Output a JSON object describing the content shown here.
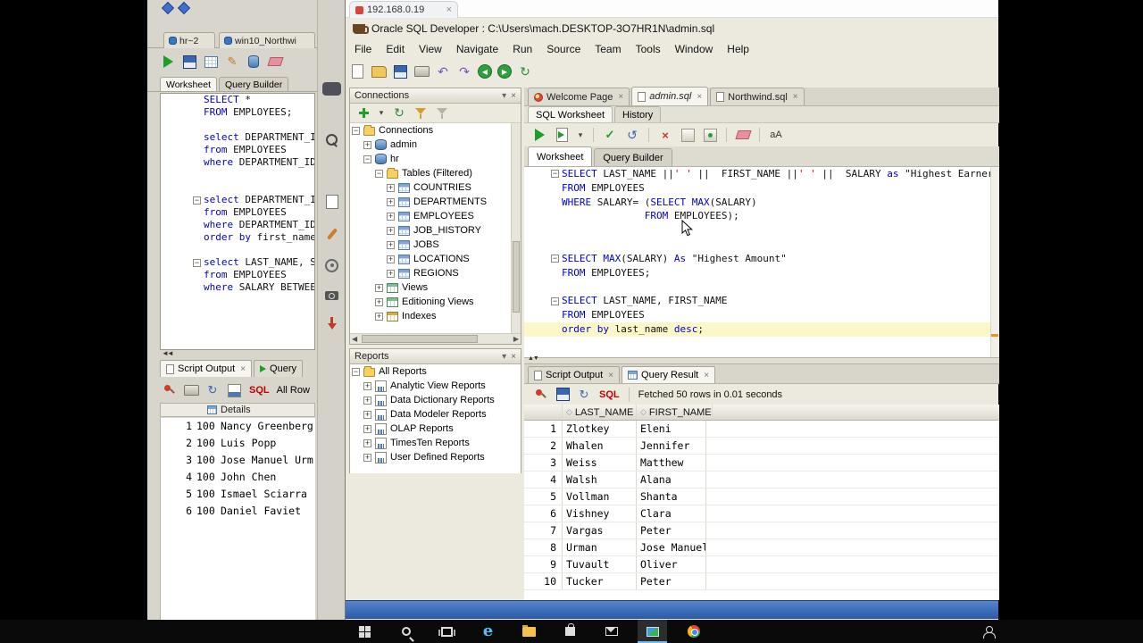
{
  "capture_toolbar": {
    "icons": [
      "capture-button",
      "magnifier",
      "clipboard",
      "brush",
      "gear",
      "camera",
      "download"
    ]
  },
  "background_window": {
    "doc_tabs": [
      {
        "label": "hr~2"
      },
      {
        "label": "win10_Northwi"
      }
    ],
    "toolbar_icons": [
      "run-statement",
      "save",
      "grid",
      "pencil",
      "db",
      "clear"
    ],
    "worksheet_tabs": {
      "worksheet": "Worksheet",
      "query_builder": "Query Builder"
    },
    "code": [
      {
        "t": [
          [
            "k",
            "SELECT"
          ],
          [
            "p",
            " *"
          ]
        ]
      },
      {
        "t": [
          [
            "k",
            "FROM"
          ],
          [
            "p",
            " EMPLOYEES;"
          ]
        ]
      },
      {
        "t": []
      },
      {
        "t": [
          [
            "k",
            "select"
          ],
          [
            "p",
            " DEPARTMENT_I"
          ]
        ]
      },
      {
        "t": [
          [
            "k",
            "from"
          ],
          [
            "p",
            " EMPLOYEES"
          ]
        ]
      },
      {
        "t": [
          [
            "k",
            "where"
          ],
          [
            "p",
            " DEPARTMENT_ID"
          ]
        ]
      },
      {
        "t": []
      },
      {
        "t": []
      },
      {
        "fold": true,
        "t": [
          [
            "k",
            "select"
          ],
          [
            "p",
            " DEPARTMENT_I"
          ]
        ]
      },
      {
        "t": [
          [
            "k",
            "from"
          ],
          [
            "p",
            " EMPLOYEES"
          ]
        ]
      },
      {
        "t": [
          [
            "k",
            "where"
          ],
          [
            "p",
            " DEPARTMENT_ID"
          ]
        ]
      },
      {
        "t": [
          [
            "k",
            "order"
          ],
          [
            "p",
            " "
          ],
          [
            "k",
            "by"
          ],
          [
            "p",
            " first_name"
          ]
        ]
      },
      {
        "t": []
      },
      {
        "fold": true,
        "t": [
          [
            "k",
            "select"
          ],
          [
            "p",
            " LAST_NAME, S"
          ]
        ]
      },
      {
        "t": [
          [
            "k",
            "from"
          ],
          [
            "p",
            " EMPLOYEES"
          ]
        ]
      },
      {
        "t": [
          [
            "k",
            "where"
          ],
          [
            "p",
            " SALARY BETWEE"
          ]
        ]
      }
    ],
    "bottom": {
      "tabs": [
        {
          "label": "Script Output",
          "close": "×"
        },
        {
          "label": "Query"
        }
      ],
      "toolbar_icons": [
        "pin",
        "print",
        "refresh-grid",
        "chart"
      ],
      "sql_label": "SQL",
      "rows_label": "All Row",
      "details_label": "Details",
      "rows": [
        [
          "1",
          "100",
          "Nancy Greenberg"
        ],
        [
          "2",
          "100",
          "Luis Popp"
        ],
        [
          "3",
          "100",
          "Jose Manuel Urm"
        ],
        [
          "4",
          "100",
          "John Chen"
        ],
        [
          "5",
          "100",
          "Ismael Sciarra"
        ],
        [
          "6",
          "100",
          "Daniel Faviet"
        ]
      ]
    }
  },
  "main_window": {
    "browser_tab": {
      "label": "192.168.0.19",
      "close": "×"
    },
    "title": "Oracle SQL Developer : C:\\Users\\mach.DESKTOP-3O7HR1N\\admin.sql",
    "menus": [
      "File",
      "Edit",
      "View",
      "Navigate",
      "Run",
      "Source",
      "Team",
      "Tools",
      "Window",
      "Help"
    ],
    "toolbar_icons": [
      "new-file",
      "open-file",
      "save",
      "print",
      "undo",
      "redo",
      "back",
      "forward",
      "refresh"
    ],
    "connections": {
      "title": "Connections",
      "toolbar_icons": [
        "add-connection",
        "dropdown",
        "refresh",
        "filter",
        "clear-filter"
      ],
      "tree": [
        {
          "d": 0,
          "e": "-",
          "i": "folder",
          "label": "Connections"
        },
        {
          "d": 1,
          "e": "+",
          "i": "db",
          "label": "admin"
        },
        {
          "d": 1,
          "e": "-",
          "i": "db",
          "label": "hr"
        },
        {
          "d": 2,
          "e": "-",
          "i": "folder",
          "label": "Tables (Filtered)"
        },
        {
          "d": 3,
          "e": "+",
          "i": "table",
          "label": "COUNTRIES"
        },
        {
          "d": 3,
          "e": "+",
          "i": "table",
          "label": "DEPARTMENTS"
        },
        {
          "d": 3,
          "e": "+",
          "i": "table",
          "label": "EMPLOYEES"
        },
        {
          "d": 3,
          "e": "+",
          "i": "table",
          "label": "JOB_HISTORY"
        },
        {
          "d": 3,
          "e": "+",
          "i": "table",
          "label": "JOBS"
        },
        {
          "d": 3,
          "e": "+",
          "i": "table",
          "label": "LOCATIONS"
        },
        {
          "d": 3,
          "e": "+",
          "i": "table",
          "label": "REGIONS"
        },
        {
          "d": 2,
          "e": "+",
          "i": "views",
          "label": "Views"
        },
        {
          "d": 2,
          "e": "+",
          "i": "views",
          "label": "Editioning Views"
        },
        {
          "d": 2,
          "e": "+",
          "i": "indexes",
          "label": "Indexes"
        }
      ]
    },
    "reports": {
      "title": "Reports",
      "tree": [
        {
          "d": 0,
          "e": "-",
          "i": "folder",
          "label": "All Reports"
        },
        {
          "d": 1,
          "e": "+",
          "i": "report",
          "label": "Analytic View Reports"
        },
        {
          "d": 1,
          "e": "+",
          "i": "report",
          "label": "Data Dictionary Reports"
        },
        {
          "d": 1,
          "e": "+",
          "i": "report",
          "label": "Data Modeler Reports"
        },
        {
          "d": 1,
          "e": "+",
          "i": "report",
          "label": "OLAP Reports"
        },
        {
          "d": 1,
          "e": "+",
          "i": "report",
          "label": "TimesTen Reports"
        },
        {
          "d": 1,
          "e": "+",
          "i": "report",
          "label": "User Defined Reports"
        }
      ]
    },
    "doc_tabs": [
      {
        "label": "Welcome Page",
        "close": "×"
      },
      {
        "label": "admin.sql",
        "close": "×"
      },
      {
        "label": "Northwind.sql",
        "close": "×"
      }
    ],
    "worksheet_history_tabs": {
      "sql_worksheet": "SQL Worksheet",
      "history": "History"
    },
    "editor_toolbar_icons": [
      "run-statement",
      "run-script",
      "dropdown",
      "sep",
      "commit",
      "rollback",
      "sep",
      "cancel",
      "explain-plan",
      "autotrace",
      "sep",
      "clear",
      "sep",
      "case-toggle"
    ],
    "worksheet_tabs": {
      "worksheet": "Worksheet",
      "query_builder": "Query Builder"
    },
    "code": [
      {
        "fold": true,
        "t": [
          [
            "k",
            "SELECT"
          ],
          [
            "p",
            " LAST_NAME ||"
          ],
          [
            "s",
            "' '"
          ],
          [
            "p",
            " ||  FIRST_NAME ||"
          ],
          [
            "s",
            "' '"
          ],
          [
            "p",
            " ||  SALARY "
          ],
          [
            "k",
            "as"
          ],
          [
            "p",
            " \"Highest Earner\""
          ]
        ]
      },
      {
        "t": [
          [
            "k",
            "FROM"
          ],
          [
            "p",
            " EMPLOYEES"
          ]
        ]
      },
      {
        "t": [
          [
            "k",
            "WHERE"
          ],
          [
            "p",
            " SALARY= ("
          ],
          [
            "k",
            "SELECT"
          ],
          [
            "p",
            " "
          ],
          [
            "k",
            "MAX"
          ],
          [
            "p",
            "(SALARY)"
          ]
        ]
      },
      {
        "t": [
          [
            "p",
            "              "
          ],
          [
            "k",
            "FROM"
          ],
          [
            "p",
            " EMPLOYEES);"
          ]
        ]
      },
      {
        "t": []
      },
      {
        "t": []
      },
      {
        "fold": true,
        "t": [
          [
            "k",
            "SELECT"
          ],
          [
            "p",
            " "
          ],
          [
            "k",
            "MAX"
          ],
          [
            "p",
            "(SALARY) "
          ],
          [
            "k",
            "As"
          ],
          [
            "p",
            " \"Highest Amount\""
          ]
        ]
      },
      {
        "t": [
          [
            "k",
            "FROM"
          ],
          [
            "p",
            " EMPLOYEES;"
          ]
        ]
      },
      {
        "t": []
      },
      {
        "fold": true,
        "t": [
          [
            "k",
            "SELECT"
          ],
          [
            "p",
            " LAST_NAME, FIRST_NAME"
          ]
        ]
      },
      {
        "t": [
          [
            "k",
            "FROM"
          ],
          [
            "p",
            " EMPLOYEES"
          ]
        ]
      },
      {
        "hl": true,
        "t": [
          [
            "k",
            "order"
          ],
          [
            "p",
            " "
          ],
          [
            "k",
            "by"
          ],
          [
            "p",
            " last_name "
          ],
          [
            "k",
            "desc"
          ],
          [
            "p",
            ";"
          ]
        ]
      }
    ],
    "results": {
      "tabs": [
        {
          "label": "Script Output",
          "close": "×"
        },
        {
          "label": "Query Result",
          "close": "×"
        }
      ],
      "toolbar_icons": [
        "pin",
        "save-grid",
        "refresh-grid"
      ],
      "sql_label": "SQL",
      "status": "Fetched 50 rows in 0.01 seconds",
      "columns": [
        "LAST_NAME",
        "FIRST_NAME"
      ],
      "rows": [
        [
          "1",
          "Zlotkey",
          "Eleni"
        ],
        [
          "2",
          "Whalen",
          "Jennifer"
        ],
        [
          "3",
          "Weiss",
          "Matthew"
        ],
        [
          "4",
          "Walsh",
          "Alana"
        ],
        [
          "5",
          "Vollman",
          "Shanta"
        ],
        [
          "6",
          "Vishney",
          "Clara"
        ],
        [
          "7",
          "Vargas",
          "Peter"
        ],
        [
          "8",
          "Urman",
          "Jose Manuel"
        ],
        [
          "9",
          "Tuvault",
          "Oliver"
        ],
        [
          "10",
          "Tucker",
          "Peter"
        ]
      ]
    }
  },
  "taskbar": {
    "icons": [
      {
        "n": "start"
      },
      {
        "n": "search"
      },
      {
        "n": "taskview"
      },
      {
        "n": "edge"
      },
      {
        "n": "explorer"
      },
      {
        "n": "store"
      },
      {
        "n": "mail"
      },
      {
        "n": "capture",
        "active": true
      },
      {
        "n": "chrome"
      }
    ],
    "right": [
      {
        "n": "people"
      }
    ]
  }
}
